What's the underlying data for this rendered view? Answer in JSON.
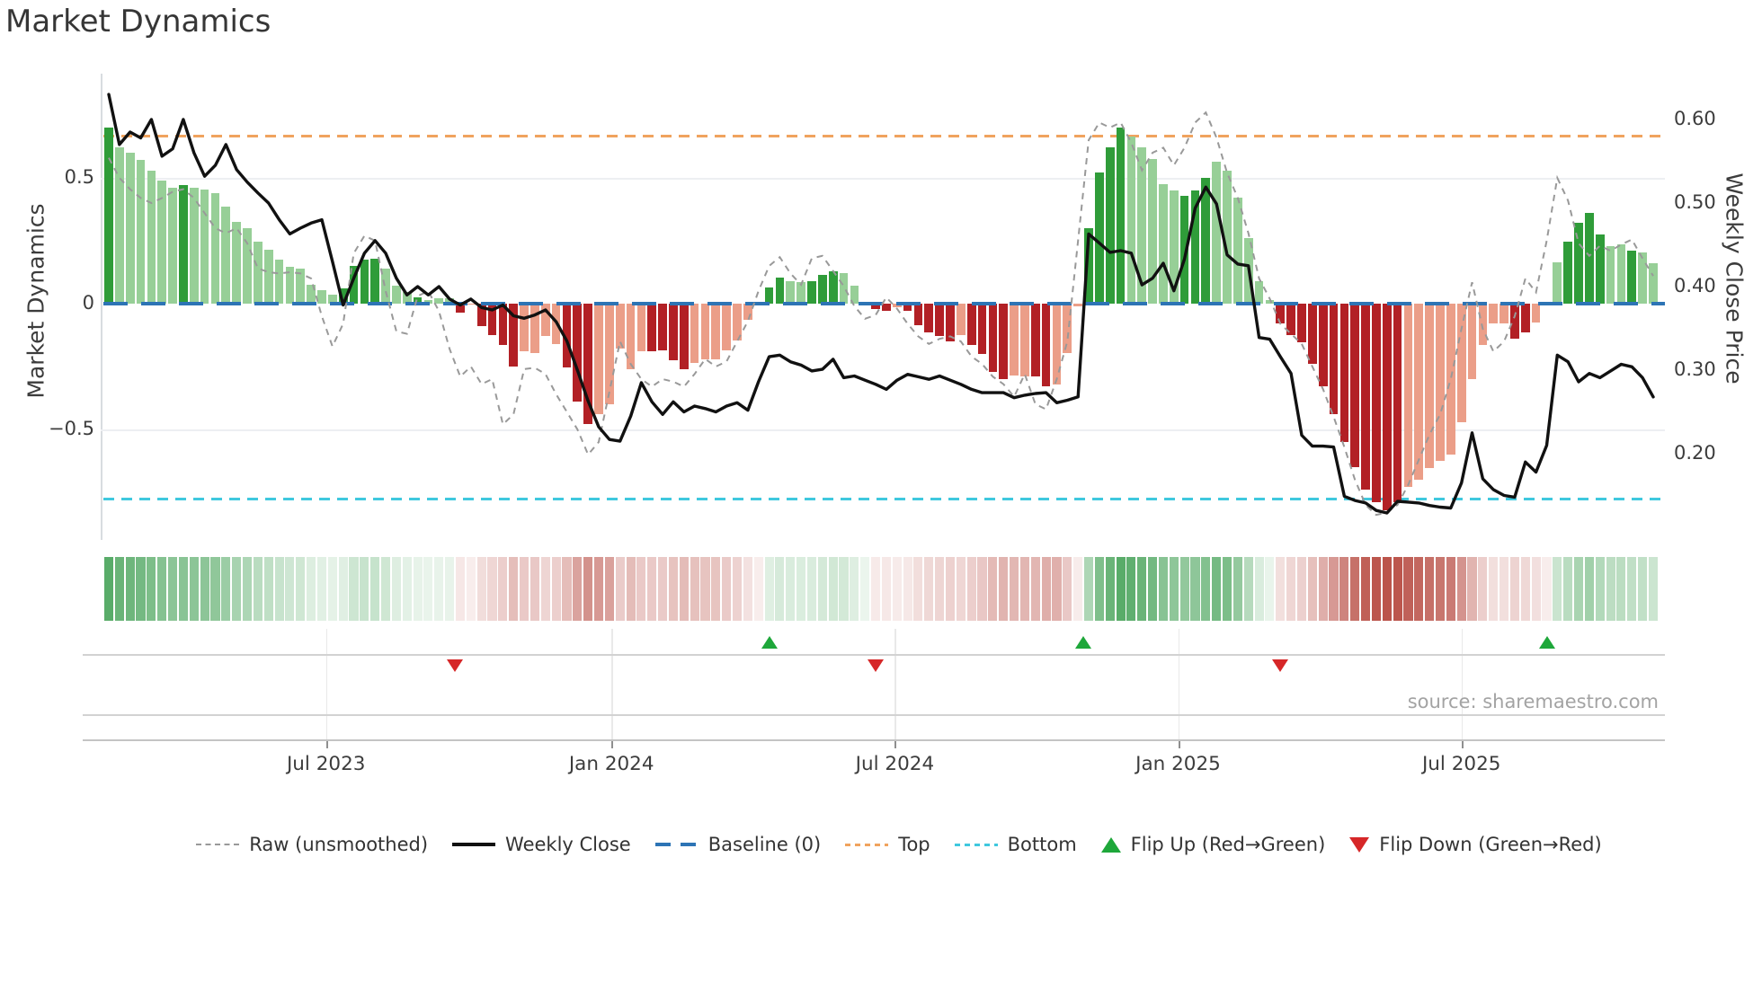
{
  "page": {
    "title": "Market Dynamics",
    "source": "source: sharemaestro.com"
  },
  "axes": {
    "left": {
      "label": "Market Dynamics",
      "tick_labels": [
        "0.5",
        "0",
        "−0.5"
      ],
      "tick_values": [
        0.5,
        0,
        -0.5
      ],
      "range": [
        -0.94,
        0.91
      ]
    },
    "right": {
      "label": "Weekly Close Price",
      "tick_labels": [
        "0.60",
        "0.50",
        "0.40",
        "0.30",
        "0.20"
      ],
      "tick_values": [
        0.6,
        0.5,
        0.4,
        0.3,
        0.2
      ],
      "range": [
        0.1,
        0.65
      ]
    },
    "x": {
      "tick_labels": [
        "Jul 2023",
        "Jan 2024",
        "Jul 2024",
        "Jan 2025",
        "Jul 2025"
      ],
      "tick_positions_weeks": [
        20.4,
        47.2,
        73.8,
        100.4,
        127.0
      ]
    }
  },
  "legend": [
    {
      "id": "raw",
      "label": "Raw (unsmoothed)",
      "swatch": "dash-gray"
    },
    {
      "id": "weekly-close",
      "label": "Weekly Close",
      "swatch": "line-black"
    },
    {
      "id": "baseline",
      "label": "Baseline (0)",
      "swatch": "dash-blue"
    },
    {
      "id": "top",
      "label": "Top",
      "swatch": "dot-orange"
    },
    {
      "id": "bottom",
      "label": "Bottom",
      "swatch": "dot-cyan"
    },
    {
      "id": "flip-up",
      "label": "Flip Up (Red→Green)",
      "swatch": "tri-up"
    },
    {
      "id": "flip-down",
      "label": "Flip Down (Green→Red)",
      "swatch": "tri-down"
    }
  ],
  "colors": {
    "bar_dark_green": "#2f9c39",
    "bar_light_green": "#97cf97",
    "bar_dark_red": "#b22025",
    "bar_light_red": "#eb9e88",
    "baseline_blue": "#2d74b5",
    "top_orange": "#f0a35e",
    "bottom_cyan": "#3fc8de",
    "raw_gray": "#999999",
    "close_black": "#111111",
    "flip_up_green": "#1ea73a",
    "flip_down_red": "#d62728",
    "heat_green": "#44a156",
    "heat_red": "#bb544b",
    "grid_gray": "#edeff2",
    "spine_gray": "#d8dce0"
  },
  "chart_data": {
    "type": "combo",
    "title": "Market Dynamics",
    "description": "Weekly oscillator bars (left axis) with raw unsmoothed line, weekly close price (right axis), baseline/top/bottom reference lines, heatmap strip of oscillator intensity, and regime flip markers.",
    "n_weeks": 146,
    "baseline_value": 0,
    "top_value": 0.67,
    "bottom_value": -0.77,
    "flip_up_weeks": [
      62,
      91.5,
      135
    ],
    "flip_down_weeks": [
      32.5,
      72,
      110
    ],
    "series_weekly": {
      "oscillator": [
        0.7,
        0.62,
        0.6,
        0.57,
        0.53,
        0.49,
        0.46,
        0.47,
        0.46,
        0.455,
        0.44,
        0.385,
        0.325,
        0.3,
        0.245,
        0.215,
        0.175,
        0.145,
        0.14,
        0.075,
        0.055,
        0.035,
        0.06,
        0.15,
        0.175,
        0.18,
        0.14,
        0.07,
        0.045,
        0.025,
        0.015,
        0.02,
        0.02,
        -0.035,
        -0.005,
        -0.09,
        -0.125,
        -0.165,
        -0.25,
        -0.19,
        -0.195,
        -0.13,
        -0.16,
        -0.255,
        -0.39,
        -0.48,
        -0.44,
        -0.4,
        -0.18,
        -0.26,
        -0.19,
        -0.19,
        -0.185,
        -0.225,
        -0.26,
        -0.235,
        -0.22,
        -0.22,
        -0.185,
        -0.145,
        -0.065,
        -0.005,
        0.065,
        0.105,
        0.09,
        0.085,
        0.09,
        0.115,
        0.13,
        0.12,
        0.07,
        0.005,
        -0.02,
        -0.03,
        -0.015,
        -0.03,
        -0.085,
        -0.115,
        -0.13,
        -0.15,
        -0.125,
        -0.165,
        -0.2,
        -0.27,
        -0.3,
        -0.285,
        -0.29,
        -0.29,
        -0.33,
        -0.32,
        -0.195,
        -0.01,
        0.3,
        0.52,
        0.62,
        0.7,
        0.665,
        0.62,
        0.575,
        0.475,
        0.45,
        0.43,
        0.45,
        0.5,
        0.565,
        0.53,
        0.42,
        0.26,
        0.09,
        0.015,
        -0.08,
        -0.125,
        -0.155,
        -0.24,
        -0.33,
        -0.44,
        -0.55,
        -0.65,
        -0.74,
        -0.79,
        -0.82,
        -0.79,
        -0.73,
        -0.7,
        -0.655,
        -0.625,
        -0.6,
        -0.47,
        -0.3,
        -0.165,
        -0.08,
        -0.08,
        -0.14,
        -0.115,
        -0.075,
        -0.005,
        0.165,
        0.245,
        0.32,
        0.36,
        0.275,
        0.23,
        0.235,
        0.21,
        0.205,
        0.16
      ],
      "oscillator_shade": "dlllllldllllllllllllllddddllldllldlddddllllddd llllldddd lllllllddlldddlllddl ddddd ldddd llddlllddd dlllll dddllllllddddddddddddlllllllll lddllldddd lldlll",
      "raw": [
        0.58,
        0.5,
        0.455,
        0.42,
        0.4,
        0.42,
        0.445,
        0.455,
        0.42,
        0.36,
        0.3,
        0.28,
        0.3,
        0.24,
        0.14,
        0.125,
        0.12,
        0.125,
        0.12,
        0.1,
        -0.05,
        -0.17,
        -0.08,
        0.2,
        0.27,
        0.25,
        0.05,
        -0.11,
        -0.12,
        0.03,
        0.05,
        -0.03,
        -0.18,
        -0.29,
        -0.25,
        -0.32,
        -0.3,
        -0.48,
        -0.44,
        -0.26,
        -0.255,
        -0.28,
        -0.36,
        -0.43,
        -0.5,
        -0.6,
        -0.55,
        -0.35,
        -0.15,
        -0.24,
        -0.3,
        -0.33,
        -0.3,
        -0.31,
        -0.33,
        -0.28,
        -0.22,
        -0.25,
        -0.23,
        -0.15,
        -0.07,
        0.05,
        0.15,
        0.185,
        0.12,
        0.075,
        0.18,
        0.19,
        0.13,
        0.07,
        -0.01,
        -0.06,
        -0.045,
        0.025,
        -0.02,
        -0.08,
        -0.13,
        -0.16,
        -0.14,
        -0.13,
        -0.15,
        -0.21,
        -0.24,
        -0.29,
        -0.32,
        -0.37,
        -0.28,
        -0.4,
        -0.42,
        -0.3,
        -0.15,
        0.25,
        0.65,
        0.72,
        0.7,
        0.72,
        0.64,
        0.53,
        0.6,
        0.62,
        0.55,
        0.62,
        0.72,
        0.76,
        0.66,
        0.52,
        0.42,
        0.28,
        0.1,
        0.02,
        -0.08,
        -0.12,
        -0.16,
        -0.25,
        -0.34,
        -0.45,
        -0.57,
        -0.7,
        -0.8,
        -0.84,
        -0.83,
        -0.8,
        -0.72,
        -0.62,
        -0.52,
        -0.44,
        -0.3,
        -0.1,
        0.085,
        -0.1,
        -0.19,
        -0.15,
        -0.05,
        0.1,
        0.045,
        0.25,
        0.5,
        0.41,
        0.24,
        0.19,
        0.23,
        0.21,
        0.235,
        0.255,
        0.18,
        0.11
      ],
      "weekly_close": [
        0.63,
        0.57,
        0.585,
        0.578,
        0.6,
        0.556,
        0.565,
        0.6,
        0.56,
        0.532,
        0.545,
        0.57,
        0.54,
        0.525,
        0.512,
        0.5,
        0.48,
        0.463,
        0.47,
        0.476,
        0.48,
        0.43,
        0.378,
        0.41,
        0.44,
        0.455,
        0.44,
        0.41,
        0.39,
        0.4,
        0.39,
        0.4,
        0.385,
        0.378,
        0.385,
        0.375,
        0.372,
        0.378,
        0.365,
        0.362,
        0.366,
        0.372,
        0.358,
        0.335,
        0.3,
        0.263,
        0.232,
        0.217,
        0.215,
        0.245,
        0.285,
        0.262,
        0.247,
        0.262,
        0.25,
        0.257,
        0.254,
        0.25,
        0.257,
        0.261,
        0.252,
        0.286,
        0.316,
        0.318,
        0.31,
        0.306,
        0.299,
        0.301,
        0.313,
        0.291,
        0.293,
        0.288,
        0.283,
        0.277,
        0.288,
        0.295,
        0.292,
        0.289,
        0.293,
        0.288,
        0.283,
        0.277,
        0.273,
        0.273,
        0.273,
        0.267,
        0.27,
        0.272,
        0.273,
        0.261,
        0.264,
        0.268,
        0.463,
        0.452,
        0.441,
        0.443,
        0.44,
        0.402,
        0.41,
        0.428,
        0.395,
        0.433,
        0.494,
        0.519,
        0.499,
        0.438,
        0.427,
        0.425,
        0.339,
        0.337,
        0.316,
        0.296,
        0.222,
        0.209,
        0.209,
        0.208,
        0.149,
        0.144,
        0.141,
        0.132,
        0.129,
        0.143,
        0.142,
        0.141,
        0.138,
        0.136,
        0.135,
        0.165,
        0.225,
        0.17,
        0.157,
        0.15,
        0.148,
        0.19,
        0.178,
        0.21,
        0.318,
        0.31,
        0.286,
        0.296,
        0.291,
        0.299,
        0.307,
        0.304,
        0.291,
        0.268
      ]
    },
    "heatmap": {
      "type": "heatmap",
      "maps_series": "oscillator",
      "rows": 1
    }
  }
}
